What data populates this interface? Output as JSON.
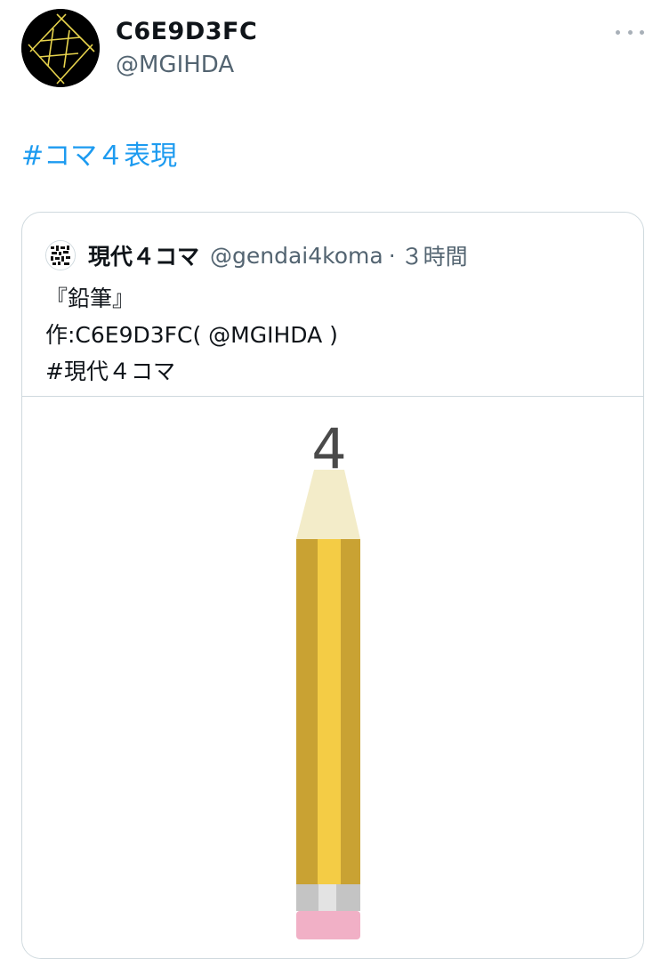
{
  "author": {
    "display_name": "C6E9D3FC",
    "handle": "@MGIHDA",
    "avatar_icon": "hash-grid-avatar-icon",
    "more_icon": "more-dots-icon"
  },
  "tweet": {
    "hashtag": "#コマ４表現"
  },
  "quote": {
    "display_name": "現代４コマ",
    "handle": "@gendai4koma",
    "separator": "·",
    "time": "３時間",
    "lines": [
      "『鉛筆』",
      "作:C6E9D3FC( @MGIHDA )",
      "#現代４コマ"
    ]
  },
  "media": {
    "number_label": "4",
    "colors": {
      "wood": "#f3ecc9",
      "body_outer": "#c9a233",
      "body_center": "#f4cc45",
      "ferrule": "#c4c4c4",
      "ferrule_center": "#e3e3e3",
      "eraser": "#f1b0c6",
      "lead": "#4a4a4a",
      "link": "#1d9bf0"
    }
  }
}
